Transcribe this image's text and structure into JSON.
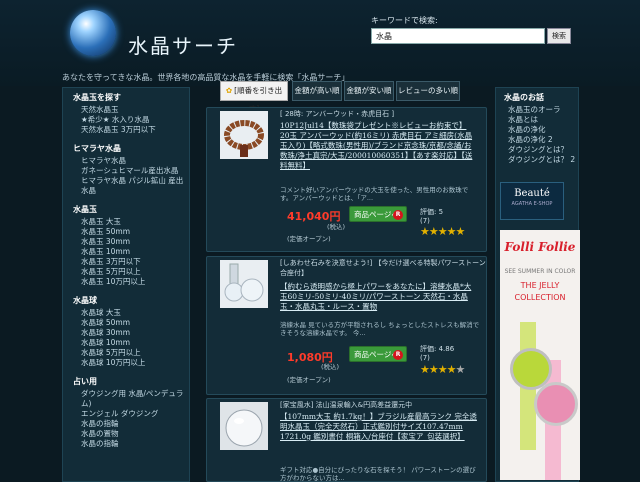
{
  "header": {
    "site_title": "水晶サーチ",
    "tagline": "あなたを守ってきな水晶。世界各地の高品質な水晶を手軽に検索「水晶サーチ」",
    "search_label": "キーワードで検索:",
    "search_value": "水晶",
    "search_button": "検索"
  },
  "sort": {
    "options": [
      "[順番を引き出す]",
      "金額が高い順",
      "金額が安い順",
      "レビューの多い順"
    ]
  },
  "left_sidebar": {
    "sections": [
      {
        "heading": "水晶玉を探す",
        "items": [
          "天然水晶玉",
          "★希少★ 水入り水晶",
          "天然水晶玉 3万円以下"
        ]
      },
      {
        "heading": "ヒマラヤ水晶",
        "items": [
          "ヒマラヤ水晶",
          "ガネーシュヒマール産出水晶",
          "ヒマラヤ水晶 パジル鉱山 産出",
          "水晶"
        ]
      },
      {
        "heading": "水晶玉",
        "items": [
          "水晶玉 大玉",
          "水晶玉 50mm",
          "水晶玉 30mm",
          "水晶玉 10mm",
          "水晶玉 3万円以下",
          "水晶玉 5万円以上",
          "水晶玉 10万円以上"
        ]
      },
      {
        "heading": "水晶球",
        "items": [
          "水晶球 大玉",
          "水晶球 50mm",
          "水晶球 30mm",
          "水晶球 10mm",
          "水晶球 5万円以上",
          "水晶球 10万円以上"
        ]
      },
      {
        "heading": "占い用",
        "items": [
          "ダウジング用 水晶/ペンデュラム)",
          "エンジェル ダウジング",
          "水晶の指輪",
          "水晶の置物",
          "水晶の指輪"
        ]
      }
    ]
  },
  "right_sidebar": {
    "heading": "水晶のお話",
    "items": [
      "水晶玉のオーラ",
      "水晶とは",
      "水晶の浄化",
      "水晶の浄化 2",
      "ダウジングとは？",
      "ダウジングとは？ 2"
    ]
  },
  "ads": {
    "beaute_title": "Beauté",
    "beaute_sub": "AGATHA E-SHOP",
    "folli_logo": "Folli Follie",
    "folli_line1": "SEE SUMMER IN COLOR",
    "folli_line2": "THE JELLY COLLECTION"
  },
  "products": [
    {
      "shop": "[ 28時: アンバーウッド・赤虎目石 ]",
      "title": "10P12Jul14【数珠袋プレゼント※レビューお約束で】20玉 アンバーウッド(約16ミリ) 赤虎目石 アミ細房(水晶玉入り)【略式数珠(男性用)/ブランド京念珠/京都/念誦/お数珠/浄土真宗/大玉/200010060351】【あす楽対応】【送料無料】",
      "desc": "コメント好いアンバーウッドの大玉を使った、男性用のお数珠です。アンバーウッドとは、「ア...",
      "price": "41,040円",
      "tax": "(税込)",
      "note": "(定価オープン)",
      "button": "商品ページへ",
      "review": "評価: 5",
      "review_count": "(7)",
      "stars": 5,
      "r_icon": "R"
    },
    {
      "shop": "[しあわせ石みを決意せよう!] 【今だけ選べる特製パワーストーン合座付】",
      "title": "【約むら透明感から極上パワーをあなたに】溶練水晶*大玉60ミリ-50ミリ-40ミリ/パワーストーン 天然石・水晶玉・水晶丸玉・ルース・置物",
      "desc": "溶練水晶 見ている方が平穏されるし ちょっとしたストレスも解消できそうな溶練水晶です。 今...",
      "price": "1,080円",
      "tax": "(税込)",
      "note": "(定価オープン)",
      "button": "商品ページへ",
      "review": "評価: 4.86",
      "review_count": "(7)",
      "stars": 4,
      "r_icon": "R"
    },
    {
      "shop": "[家宝風水] 法山温泉輸入&円高差益還元中",
      "title": "【107mm大玉 約1.7kg！】ブラジル産最高ランク 完全透明水晶玉（完全天然石）正式鑑別付サイズ107.47mm 1721.0g 鑑別書付 桐箱入/台座付【家宝ア_包装選択】",
      "desc": "ギフト対応●自分にぴったりな石を探そう！ パワーストーンの選び方がわからない方は..."
    }
  ]
}
